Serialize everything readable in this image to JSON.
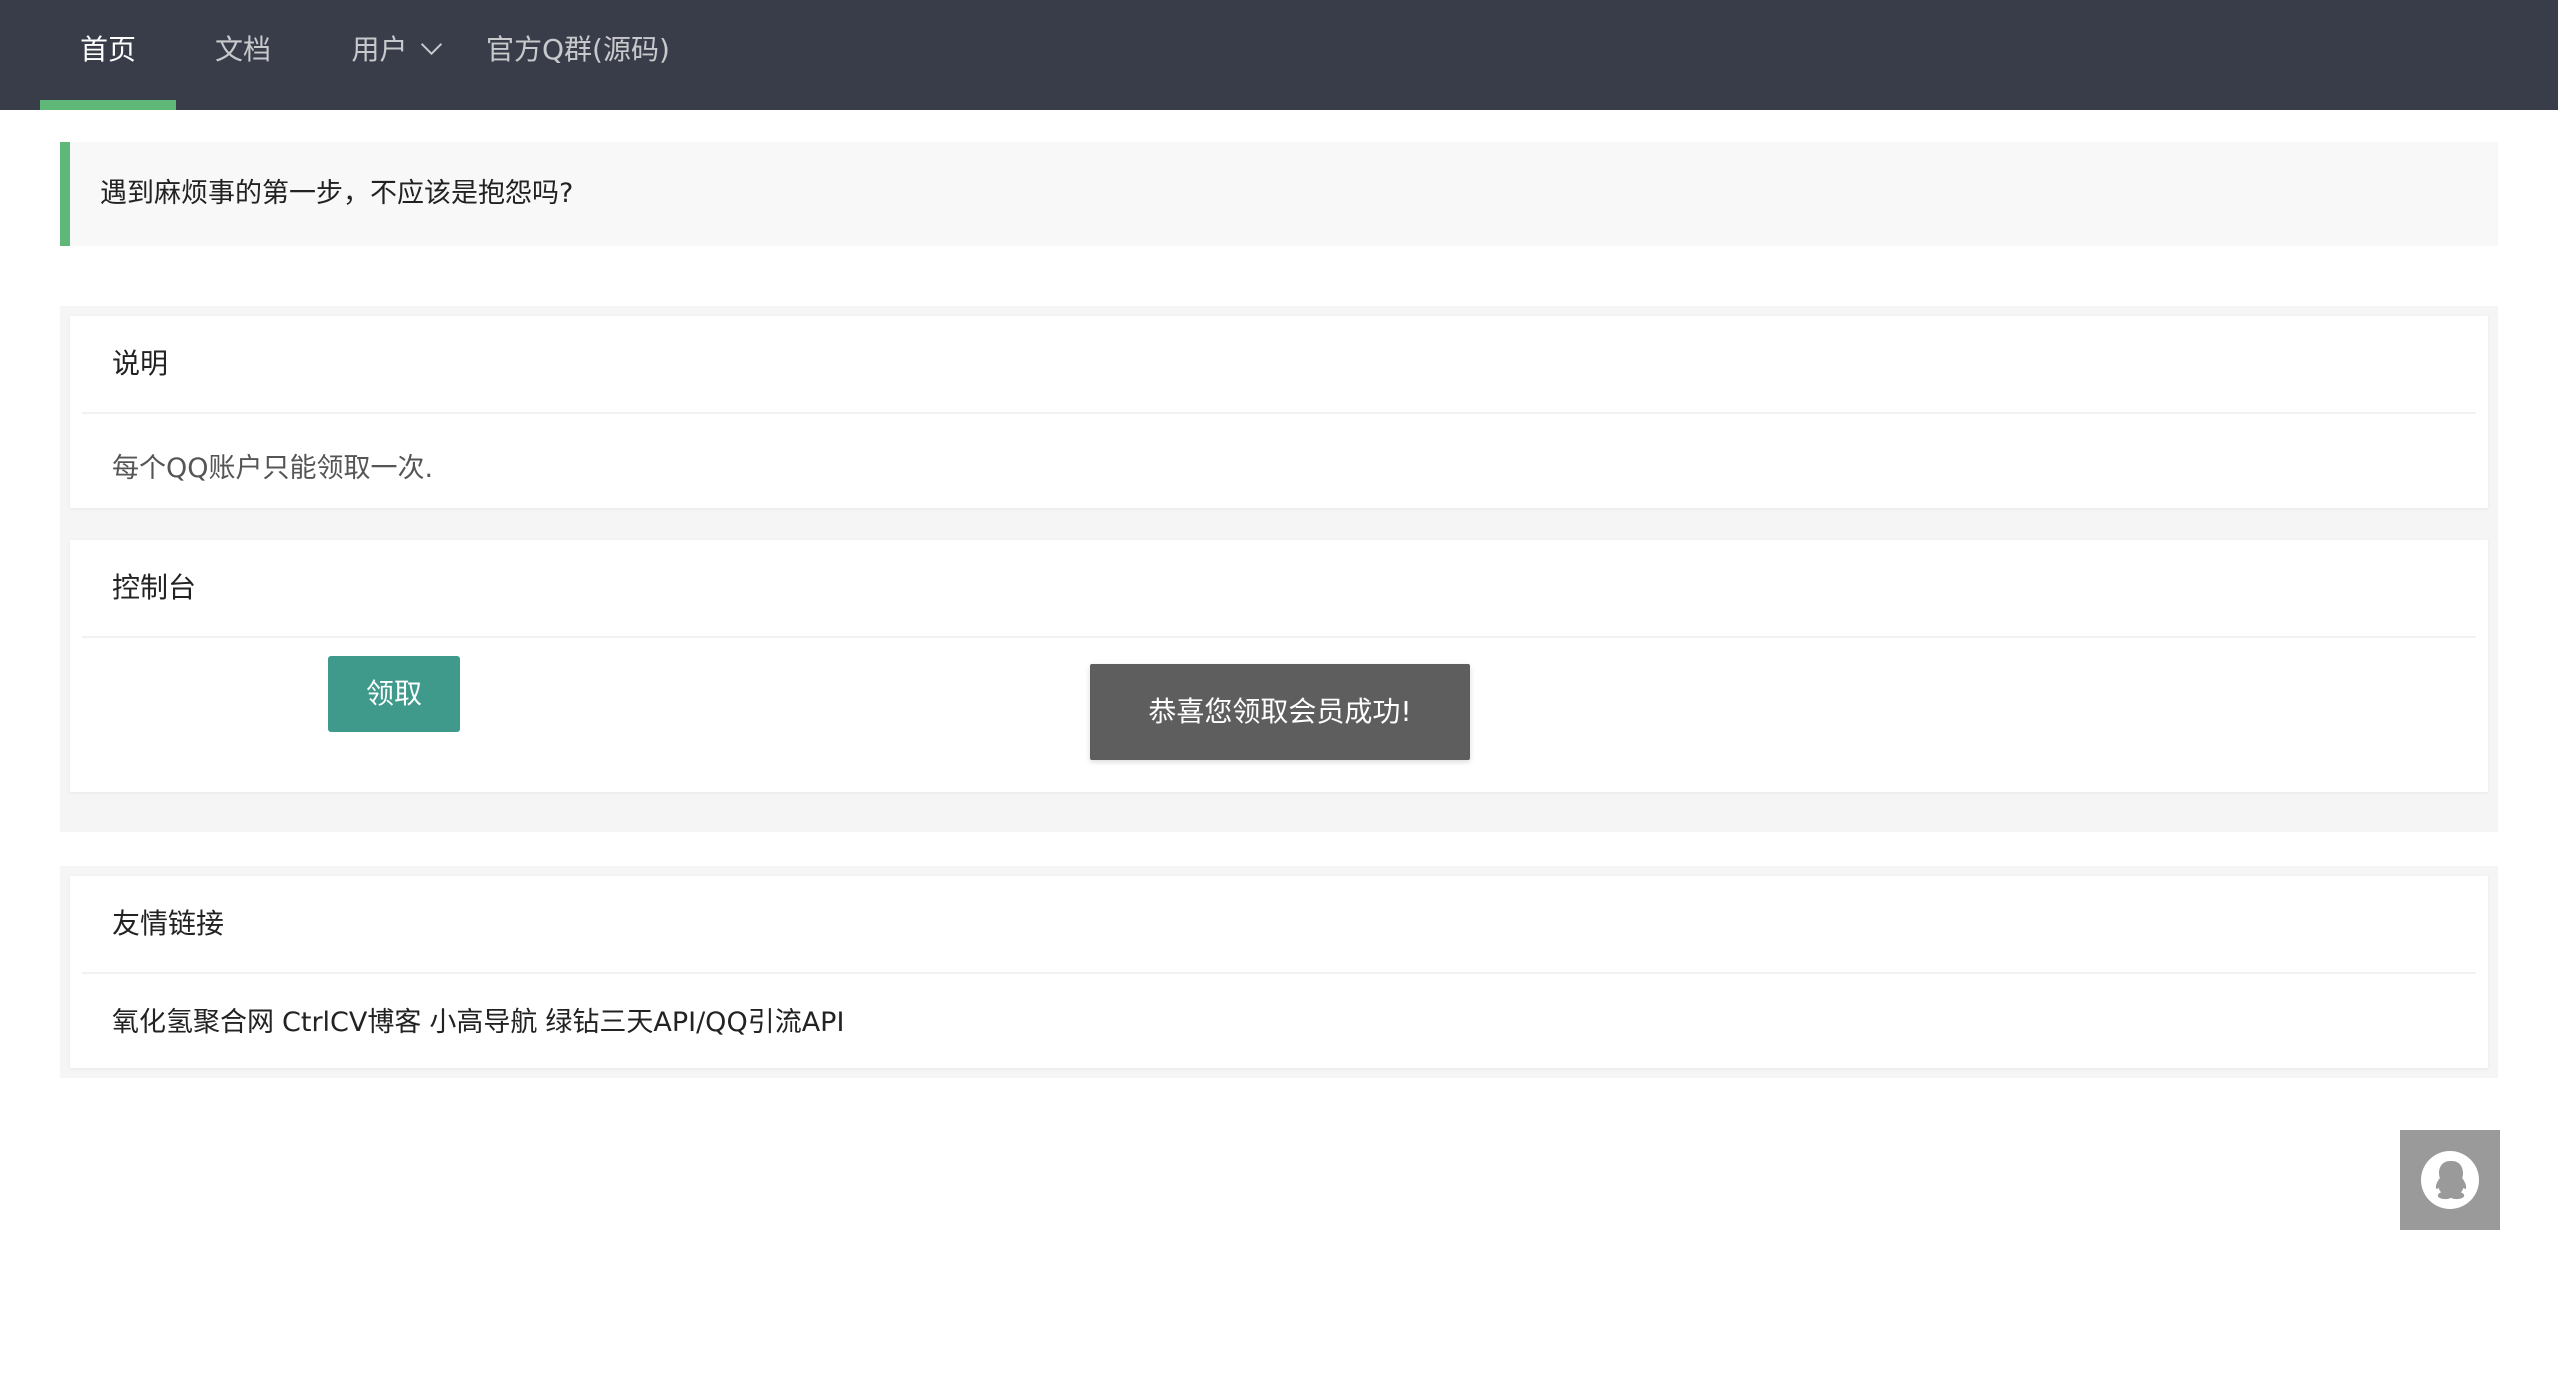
{
  "nav": {
    "items": [
      {
        "label": "首页",
        "active": true
      },
      {
        "label": "文档"
      },
      {
        "label": "用户",
        "has_dropdown": true
      },
      {
        "label": "官方Q群(源码)"
      }
    ]
  },
  "quote": {
    "text": "遇到麻烦事的第一步，不应该是抱怨吗?"
  },
  "notice_card": {
    "title": "说明",
    "body": "每个QQ账户只能领取一次."
  },
  "console_card": {
    "title": "控制台",
    "claim_button": "领取"
  },
  "toast": {
    "message": "恭喜您领取会员成功!"
  },
  "links_card": {
    "title": "友情链接",
    "links": [
      "氧化氢聚合网",
      "CtrlCV博客",
      "小高导航",
      "绿钻三天API/QQ引流API"
    ]
  },
  "float_button": {
    "icon": "qq-penguin-icon"
  },
  "colors": {
    "nav_bg": "#393d49",
    "accent_green": "#5fb878",
    "button_teal": "#3f9a8c",
    "toast_bg": "#5e5e5e"
  }
}
